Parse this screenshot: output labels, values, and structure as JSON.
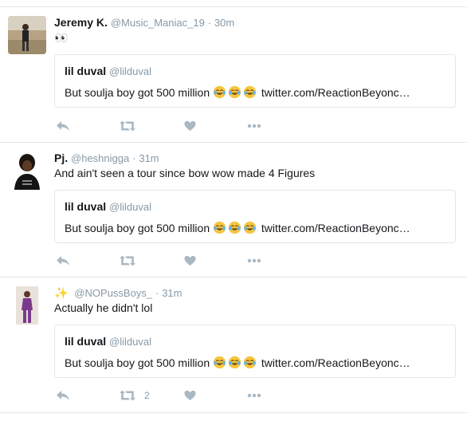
{
  "tweets": [
    {
      "name": "Jeremy K.",
      "handle": "@Music_Maniac_19",
      "sep": "·",
      "time": "30m",
      "text": "👀",
      "quote": {
        "name": "lil duval",
        "handle": "@lilduval",
        "text_before": "But soulja boy got 500 million",
        "link": "twitter.com/ReactionBeyonc…"
      },
      "retweet_count": ""
    },
    {
      "name": "Pj.",
      "handle": "@heshnigga",
      "sep": "·",
      "time": "31m",
      "text": "And ain't seen a tour since bow wow made 4 Figures",
      "quote": {
        "name": "lil duval",
        "handle": "@lilduval",
        "text_before": "But soulja boy got 500 million",
        "link": "twitter.com/ReactionBeyonc…"
      },
      "retweet_count": ""
    },
    {
      "name": "✨",
      "handle": "@NOPussBoys_",
      "sep": "·",
      "time": "31m",
      "text": "Actually he didn't lol",
      "quote": {
        "name": "lil duval",
        "handle": "@lilduval",
        "text_before": "But soulja boy got 500 million",
        "link": "twitter.com/ReactionBeyonc…"
      },
      "retweet_count": "2"
    }
  ],
  "icons": {
    "reply": "reply-icon",
    "retweet": "retweet-icon",
    "like": "heart-icon",
    "more": "more-icon",
    "emoji": "face-with-tears-of-joy"
  },
  "colors": {
    "icon": "#aab8c2",
    "muted": "#8899a6",
    "border": "#e1e8ed"
  }
}
